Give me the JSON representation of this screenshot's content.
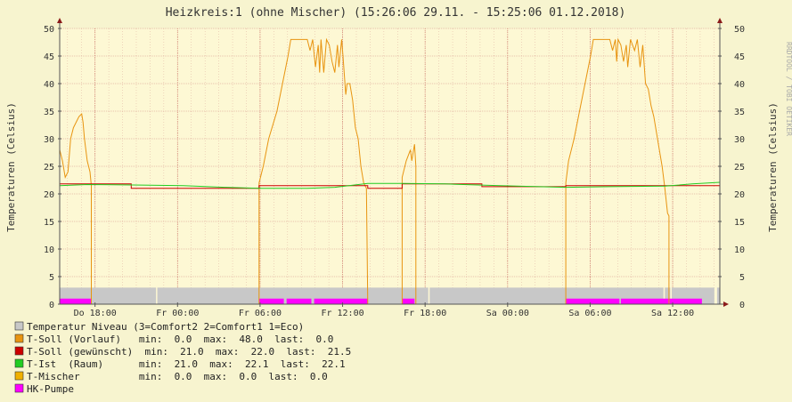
{
  "colors": {
    "background": "#f7f4cf",
    "plot_area": "#fdf8d4",
    "grid": "#e0b0a0",
    "axis": "#555555",
    "arrow": "#8b1a1a",
    "niveau": "#c8c8c8",
    "vorlauf": "#e89410",
    "soll": "#cc0000",
    "ist": "#22cc22",
    "mischer": "#f0b000",
    "pumpe": "#ff00ff"
  },
  "chart_data": {
    "type": "line",
    "title": "Heizkreis:1 (ohne Mischer) (15:26:06 29.11. - 15:25:06 01.12.2018)",
    "ylabel": "Temperaturen (Celsius)",
    "ylabel_right": "Temperaturen (Celsius)",
    "watermark": "RRDTOOL / TOBI OETIKER",
    "x_unit": "hours since Do 15:26",
    "xlim": [
      0,
      48
    ],
    "ylim": [
      0,
      50
    ],
    "yticks": [
      0,
      5,
      10,
      15,
      20,
      25,
      30,
      35,
      40,
      45,
      50
    ],
    "xticks": [
      {
        "x": 2.57,
        "label": "Do 18:00"
      },
      {
        "x": 8.57,
        "label": "Fr 00:00"
      },
      {
        "x": 14.57,
        "label": "Fr 06:00"
      },
      {
        "x": 20.57,
        "label": "Fr 12:00"
      },
      {
        "x": 26.57,
        "label": "Fr 18:00"
      },
      {
        "x": 32.57,
        "label": "Sa 00:00"
      },
      {
        "x": 38.57,
        "label": "Sa 06:00"
      },
      {
        "x": 44.57,
        "label": "Sa 12:00"
      }
    ],
    "series": [
      {
        "name": "Temperatur Niveau (3=Comfort2 2=Comfort1 1=Eco)",
        "style": "area",
        "color_key": "niveau",
        "points": [
          [
            0,
            3
          ],
          [
            7.0,
            3
          ],
          [
            7.0,
            0
          ],
          [
            7.1,
            0
          ],
          [
            7.1,
            3
          ],
          [
            26.8,
            3
          ],
          [
            26.8,
            0
          ],
          [
            26.9,
            0
          ],
          [
            26.9,
            3
          ],
          [
            43.9,
            3
          ],
          [
            43.9,
            0
          ],
          [
            44.0,
            0
          ],
          [
            44.0,
            3
          ],
          [
            44.4,
            3
          ],
          [
            44.4,
            0
          ],
          [
            44.5,
            0
          ],
          [
            44.5,
            3
          ],
          [
            47.6,
            3
          ],
          [
            47.6,
            0
          ],
          [
            47.8,
            0
          ],
          [
            47.8,
            3
          ],
          [
            48,
            3
          ]
        ]
      },
      {
        "name": "HK-Pumpe",
        "style": "area",
        "color_key": "pumpe",
        "points": [
          [
            0,
            0
          ],
          [
            0,
            1
          ],
          [
            2.3,
            1
          ],
          [
            2.3,
            0
          ],
          [
            14.5,
            0
          ],
          [
            14.5,
            1
          ],
          [
            16.3,
            1
          ],
          [
            16.3,
            0
          ],
          [
            16.5,
            0
          ],
          [
            16.5,
            1
          ],
          [
            18.3,
            1
          ],
          [
            18.3,
            0
          ],
          [
            18.5,
            0
          ],
          [
            18.5,
            1
          ],
          [
            22.4,
            1
          ],
          [
            22.4,
            0
          ],
          [
            24.9,
            0
          ],
          [
            24.9,
            1
          ],
          [
            25.8,
            1
          ],
          [
            25.8,
            0
          ],
          [
            36.8,
            0
          ],
          [
            36.8,
            1
          ],
          [
            40.7,
            1
          ],
          [
            40.7,
            0
          ],
          [
            40.8,
            0
          ],
          [
            40.8,
            1
          ],
          [
            46.7,
            1
          ],
          [
            46.7,
            0
          ],
          [
            48,
            0
          ]
        ]
      },
      {
        "name": "T-Soll (Vorlauf)",
        "style": "line",
        "color_key": "vorlauf",
        "stats": {
          "min": "0.0",
          "max": "48.0",
          "last": "0.0"
        },
        "points": [
          [
            0,
            28
          ],
          [
            0.2,
            26
          ],
          [
            0.4,
            23
          ],
          [
            0.6,
            24
          ],
          [
            0.8,
            30
          ],
          [
            1.0,
            32
          ],
          [
            1.2,
            33
          ],
          [
            1.4,
            34
          ],
          [
            1.6,
            34.5
          ],
          [
            1.7,
            33
          ],
          [
            1.8,
            30
          ],
          [
            2.0,
            26
          ],
          [
            2.2,
            24
          ],
          [
            2.3,
            21.5
          ],
          [
            2.3,
            0
          ],
          [
            14.5,
            0
          ],
          [
            14.5,
            22
          ],
          [
            14.8,
            25
          ],
          [
            15.2,
            30
          ],
          [
            15.8,
            35
          ],
          [
            16.2,
            40
          ],
          [
            16.6,
            45
          ],
          [
            16.8,
            48
          ],
          [
            18.0,
            48
          ],
          [
            18.2,
            46
          ],
          [
            18.4,
            48
          ],
          [
            18.6,
            43
          ],
          [
            18.8,
            47
          ],
          [
            18.9,
            42
          ],
          [
            19.0,
            48
          ],
          [
            19.2,
            42
          ],
          [
            19.4,
            48
          ],
          [
            19.6,
            47
          ],
          [
            19.8,
            44
          ],
          [
            20.0,
            42
          ],
          [
            20.2,
            47
          ],
          [
            20.3,
            43
          ],
          [
            20.5,
            48
          ],
          [
            20.6,
            45
          ],
          [
            20.8,
            38
          ],
          [
            20.9,
            40
          ],
          [
            21.1,
            40
          ],
          [
            21.3,
            37
          ],
          [
            21.5,
            32
          ],
          [
            21.7,
            30
          ],
          [
            21.9,
            25
          ],
          [
            22.1,
            22
          ],
          [
            22.3,
            21
          ],
          [
            22.4,
            0
          ],
          [
            24.9,
            0
          ],
          [
            24.9,
            23
          ],
          [
            25.2,
            26
          ],
          [
            25.5,
            28
          ],
          [
            25.6,
            26
          ],
          [
            25.8,
            29
          ],
          [
            25.9,
            25
          ],
          [
            25.9,
            0
          ],
          [
            36.8,
            0
          ],
          [
            36.8,
            22
          ],
          [
            37.0,
            26
          ],
          [
            37.4,
            30
          ],
          [
            37.8,
            35
          ],
          [
            38.2,
            40
          ],
          [
            38.6,
            45
          ],
          [
            38.8,
            48
          ],
          [
            40.0,
            48
          ],
          [
            40.2,
            46
          ],
          [
            40.4,
            48
          ],
          [
            40.5,
            44
          ],
          [
            40.6,
            48
          ],
          [
            40.8,
            47
          ],
          [
            41.0,
            44
          ],
          [
            41.2,
            47
          ],
          [
            41.3,
            43
          ],
          [
            41.5,
            48
          ],
          [
            41.8,
            46
          ],
          [
            42.0,
            48
          ],
          [
            42.2,
            43
          ],
          [
            42.4,
            47
          ],
          [
            42.6,
            40
          ],
          [
            42.8,
            39
          ],
          [
            43.0,
            36
          ],
          [
            43.2,
            34
          ],
          [
            43.4,
            31
          ],
          [
            43.6,
            28
          ],
          [
            43.8,
            25
          ],
          [
            44.0,
            21
          ],
          [
            44.2,
            16.5
          ],
          [
            44.3,
            16
          ],
          [
            44.3,
            0
          ],
          [
            48,
            0
          ]
        ]
      },
      {
        "name": "T-Soll (gewünscht)",
        "style": "line",
        "color_key": "soll",
        "stats": {
          "min": "21.0",
          "max": "22.0",
          "last": "21.5"
        },
        "points": [
          [
            0,
            21.8
          ],
          [
            5.2,
            21.8
          ],
          [
            5.2,
            21.0
          ],
          [
            14.5,
            21.0
          ],
          [
            14.5,
            21.5
          ],
          [
            22.4,
            21.5
          ],
          [
            22.4,
            21.0
          ],
          [
            24.9,
            21.0
          ],
          [
            24.9,
            21.8
          ],
          [
            30.7,
            21.8
          ],
          [
            30.7,
            21.3
          ],
          [
            36.8,
            21.3
          ],
          [
            36.8,
            21.5
          ],
          [
            48,
            21.5
          ]
        ]
      },
      {
        "name": "T-Ist (Raum)",
        "style": "line",
        "color_key": "ist",
        "stats": {
          "min": "21.0",
          "max": "22.1",
          "last": "22.1"
        },
        "points": [
          [
            0,
            21.5
          ],
          [
            2.0,
            21.7
          ],
          [
            6.0,
            21.6
          ],
          [
            9.0,
            21.5
          ],
          [
            12.0,
            21.2
          ],
          [
            14.5,
            21.0
          ],
          [
            18.0,
            21.0
          ],
          [
            20.0,
            21.2
          ],
          [
            22.4,
            21.9
          ],
          [
            25.0,
            21.9
          ],
          [
            28.0,
            21.8
          ],
          [
            32.0,
            21.5
          ],
          [
            36.8,
            21.2
          ],
          [
            40.0,
            21.3
          ],
          [
            44.0,
            21.4
          ],
          [
            46.0,
            21.8
          ],
          [
            48,
            22.1
          ]
        ]
      },
      {
        "name": "T-Mischer",
        "style": "line",
        "color_key": "mischer",
        "stats": {
          "min": "0.0",
          "max": "0.0",
          "last": "0.0"
        },
        "points": [
          [
            0,
            0
          ],
          [
            48,
            0
          ]
        ]
      }
    ]
  },
  "legend": [
    {
      "color_key": "niveau",
      "text": "Temperatur Niveau (3=Comfort2 2=Comfort1 1=Eco)"
    },
    {
      "color_key": "vorlauf",
      "text": "T-Soll (Vorlauf)   min:  0.0  max:  48.0  last:  0.0"
    },
    {
      "color_key": "soll",
      "text": "T-Soll (gewünscht)  min:  21.0  max:  22.0  last:  21.5"
    },
    {
      "color_key": "ist",
      "text": "T-Ist  (Raum)      min:  21.0  max:  22.1  last:  22.1"
    },
    {
      "color_key": "mischer",
      "text": "T-Mischer          min:  0.0  max:  0.0  last:  0.0"
    },
    {
      "color_key": "pumpe",
      "text": "HK-Pumpe"
    }
  ]
}
